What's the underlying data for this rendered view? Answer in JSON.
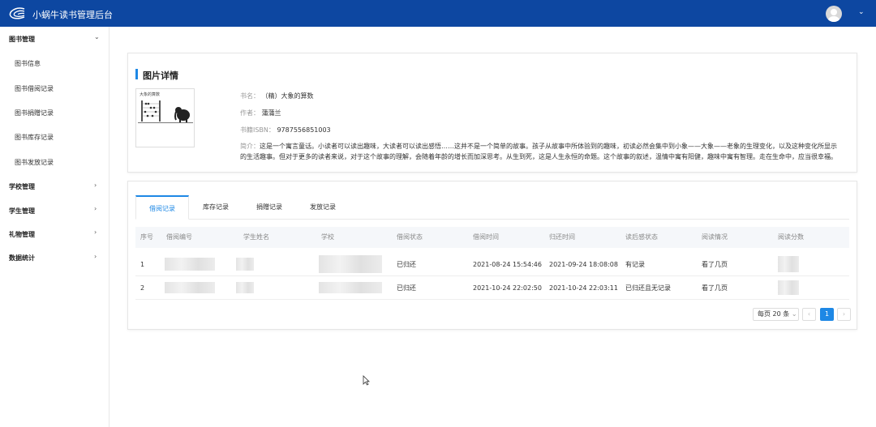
{
  "app": {
    "title": "小蜗牛读书管理后台"
  },
  "icons": {
    "logo": "logo-icon",
    "avatar": "avatar-icon",
    "chevron_down": "chevron-down-icon",
    "chevron_right": "chevron-right-icon",
    "cursor": "mouse-cursor-icon"
  },
  "colors": {
    "header_bg": "#0d47a1",
    "accent": "#1e88e5"
  },
  "sidebar": {
    "groups": [
      {
        "label": "图书管理",
        "expanded": true,
        "items": [
          "图书信息",
          "图书借阅记录",
          "图书捐赠记录",
          "图书库存记录",
          "图书发放记录"
        ]
      },
      {
        "label": "学校管理",
        "expanded": false
      },
      {
        "label": "学生管理",
        "expanded": false
      },
      {
        "label": "礼物管理",
        "expanded": false
      },
      {
        "label": "数据统计",
        "expanded": false
      }
    ]
  },
  "detail": {
    "section_title": "图片详情",
    "cover_text": "大象的算数",
    "book_name_label": "书名：",
    "book_name": "（精）大象的算数",
    "author_label": "作者：",
    "author": "蒲蒲兰",
    "isbn_label": "书籍ISBN：",
    "isbn": "9787556851003",
    "intro_label": "简介：",
    "intro": "这是一个寓言童话。小读者可以读出趣味，大读者可以读出感悟……这并不是一个简单的故事。孩子从故事中所体验到的趣味，初读必然会集中到小象——大象——老象的生理变化，以及这种变化所显示的生活趣事。但对于更多的读者来说，对于这个故事的理解，会随着年龄的增长而加深思考。从生到死，这是人生永恒的命题。这个故事的叙述，温情中寓有阳健，趣味中寓有智理。走在生命中，应当很幸福。"
  },
  "tabs": [
    "借阅记录",
    "库存记录",
    "捐赠记录",
    "发放记录"
  ],
  "active_tab": "借阅记录",
  "table": {
    "columns": [
      "序号",
      "借阅编号",
      "学生姓名",
      "学校",
      "借阅状态",
      "借阅时间",
      "归还时间",
      "读后感状态",
      "阅读情况",
      "阅读分数"
    ],
    "rows": [
      {
        "index": "1",
        "status": "已归还",
        "borrow_time": "2021-08-24 15:54:46",
        "return_time": "2021-09-24 18:08:08",
        "review_status": "有记录",
        "reading": "看了几页"
      },
      {
        "index": "2",
        "status": "已归还",
        "borrow_time": "2021-10-24 22:02:50",
        "return_time": "2021-10-24 22:03:11",
        "review_status": "已归还且无记录",
        "reading": "看了几页"
      }
    ]
  },
  "pagination": {
    "page_size": "每页 20 条",
    "prev": "‹",
    "current_page": "1",
    "next": "›"
  }
}
